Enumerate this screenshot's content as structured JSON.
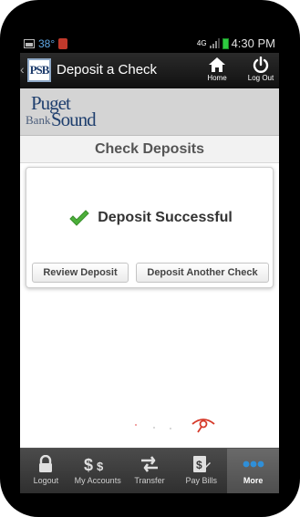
{
  "status_bar": {
    "temperature": "38°",
    "network": "4G",
    "time": "4:30 PM"
  },
  "action_bar": {
    "logo_text": "PSB",
    "title": "Deposit a Check",
    "home_label": "Home",
    "logout_label": "Log Out"
  },
  "brand": {
    "line1": "Puget",
    "line2a": "Bank",
    "line2b": "Sound"
  },
  "page": {
    "heading": "Check Deposits"
  },
  "result": {
    "message": "Deposit Successful",
    "review_button": "Review Deposit",
    "another_button": "Deposit Another Check",
    "icon": "checkmark-icon",
    "icon_color": "#4caf3a"
  },
  "tab_bar": {
    "tabs": [
      {
        "label": "Logout",
        "icon": "lock-icon"
      },
      {
        "label": "My Accounts",
        "icon": "dollar-icon"
      },
      {
        "label": "Transfer",
        "icon": "transfer-arrows-icon"
      },
      {
        "label": "Pay Bills",
        "icon": "pay-bills-icon"
      },
      {
        "label": "More",
        "icon": "more-dots-icon",
        "active": true
      }
    ]
  },
  "colors": {
    "accent_blue": "#1f3f6e",
    "more_dots": "#2f8fd8",
    "success_green": "#4caf3a"
  }
}
